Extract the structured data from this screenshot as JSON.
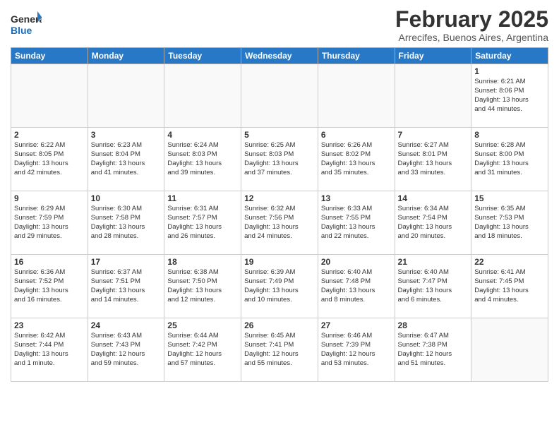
{
  "header": {
    "logo_general": "General",
    "logo_blue": "Blue",
    "month": "February 2025",
    "location": "Arrecifes, Buenos Aires, Argentina"
  },
  "days_of_week": [
    "Sunday",
    "Monday",
    "Tuesday",
    "Wednesday",
    "Thursday",
    "Friday",
    "Saturday"
  ],
  "weeks": [
    [
      {
        "day": "",
        "info": ""
      },
      {
        "day": "",
        "info": ""
      },
      {
        "day": "",
        "info": ""
      },
      {
        "day": "",
        "info": ""
      },
      {
        "day": "",
        "info": ""
      },
      {
        "day": "",
        "info": ""
      },
      {
        "day": "1",
        "info": "Sunrise: 6:21 AM\nSunset: 8:06 PM\nDaylight: 13 hours\nand 44 minutes."
      }
    ],
    [
      {
        "day": "2",
        "info": "Sunrise: 6:22 AM\nSunset: 8:05 PM\nDaylight: 13 hours\nand 42 minutes."
      },
      {
        "day": "3",
        "info": "Sunrise: 6:23 AM\nSunset: 8:04 PM\nDaylight: 13 hours\nand 41 minutes."
      },
      {
        "day": "4",
        "info": "Sunrise: 6:24 AM\nSunset: 8:03 PM\nDaylight: 13 hours\nand 39 minutes."
      },
      {
        "day": "5",
        "info": "Sunrise: 6:25 AM\nSunset: 8:03 PM\nDaylight: 13 hours\nand 37 minutes."
      },
      {
        "day": "6",
        "info": "Sunrise: 6:26 AM\nSunset: 8:02 PM\nDaylight: 13 hours\nand 35 minutes."
      },
      {
        "day": "7",
        "info": "Sunrise: 6:27 AM\nSunset: 8:01 PM\nDaylight: 13 hours\nand 33 minutes."
      },
      {
        "day": "8",
        "info": "Sunrise: 6:28 AM\nSunset: 8:00 PM\nDaylight: 13 hours\nand 31 minutes."
      }
    ],
    [
      {
        "day": "9",
        "info": "Sunrise: 6:29 AM\nSunset: 7:59 PM\nDaylight: 13 hours\nand 29 minutes."
      },
      {
        "day": "10",
        "info": "Sunrise: 6:30 AM\nSunset: 7:58 PM\nDaylight: 13 hours\nand 28 minutes."
      },
      {
        "day": "11",
        "info": "Sunrise: 6:31 AM\nSunset: 7:57 PM\nDaylight: 13 hours\nand 26 minutes."
      },
      {
        "day": "12",
        "info": "Sunrise: 6:32 AM\nSunset: 7:56 PM\nDaylight: 13 hours\nand 24 minutes."
      },
      {
        "day": "13",
        "info": "Sunrise: 6:33 AM\nSunset: 7:55 PM\nDaylight: 13 hours\nand 22 minutes."
      },
      {
        "day": "14",
        "info": "Sunrise: 6:34 AM\nSunset: 7:54 PM\nDaylight: 13 hours\nand 20 minutes."
      },
      {
        "day": "15",
        "info": "Sunrise: 6:35 AM\nSunset: 7:53 PM\nDaylight: 13 hours\nand 18 minutes."
      }
    ],
    [
      {
        "day": "16",
        "info": "Sunrise: 6:36 AM\nSunset: 7:52 PM\nDaylight: 13 hours\nand 16 minutes."
      },
      {
        "day": "17",
        "info": "Sunrise: 6:37 AM\nSunset: 7:51 PM\nDaylight: 13 hours\nand 14 minutes."
      },
      {
        "day": "18",
        "info": "Sunrise: 6:38 AM\nSunset: 7:50 PM\nDaylight: 13 hours\nand 12 minutes."
      },
      {
        "day": "19",
        "info": "Sunrise: 6:39 AM\nSunset: 7:49 PM\nDaylight: 13 hours\nand 10 minutes."
      },
      {
        "day": "20",
        "info": "Sunrise: 6:40 AM\nSunset: 7:48 PM\nDaylight: 13 hours\nand 8 minutes."
      },
      {
        "day": "21",
        "info": "Sunrise: 6:40 AM\nSunset: 7:47 PM\nDaylight: 13 hours\nand 6 minutes."
      },
      {
        "day": "22",
        "info": "Sunrise: 6:41 AM\nSunset: 7:45 PM\nDaylight: 13 hours\nand 4 minutes."
      }
    ],
    [
      {
        "day": "23",
        "info": "Sunrise: 6:42 AM\nSunset: 7:44 PM\nDaylight: 13 hours\nand 1 minute."
      },
      {
        "day": "24",
        "info": "Sunrise: 6:43 AM\nSunset: 7:43 PM\nDaylight: 12 hours\nand 59 minutes."
      },
      {
        "day": "25",
        "info": "Sunrise: 6:44 AM\nSunset: 7:42 PM\nDaylight: 12 hours\nand 57 minutes."
      },
      {
        "day": "26",
        "info": "Sunrise: 6:45 AM\nSunset: 7:41 PM\nDaylight: 12 hours\nand 55 minutes."
      },
      {
        "day": "27",
        "info": "Sunrise: 6:46 AM\nSunset: 7:39 PM\nDaylight: 12 hours\nand 53 minutes."
      },
      {
        "day": "28",
        "info": "Sunrise: 6:47 AM\nSunset: 7:38 PM\nDaylight: 12 hours\nand 51 minutes."
      },
      {
        "day": "",
        "info": ""
      }
    ]
  ]
}
